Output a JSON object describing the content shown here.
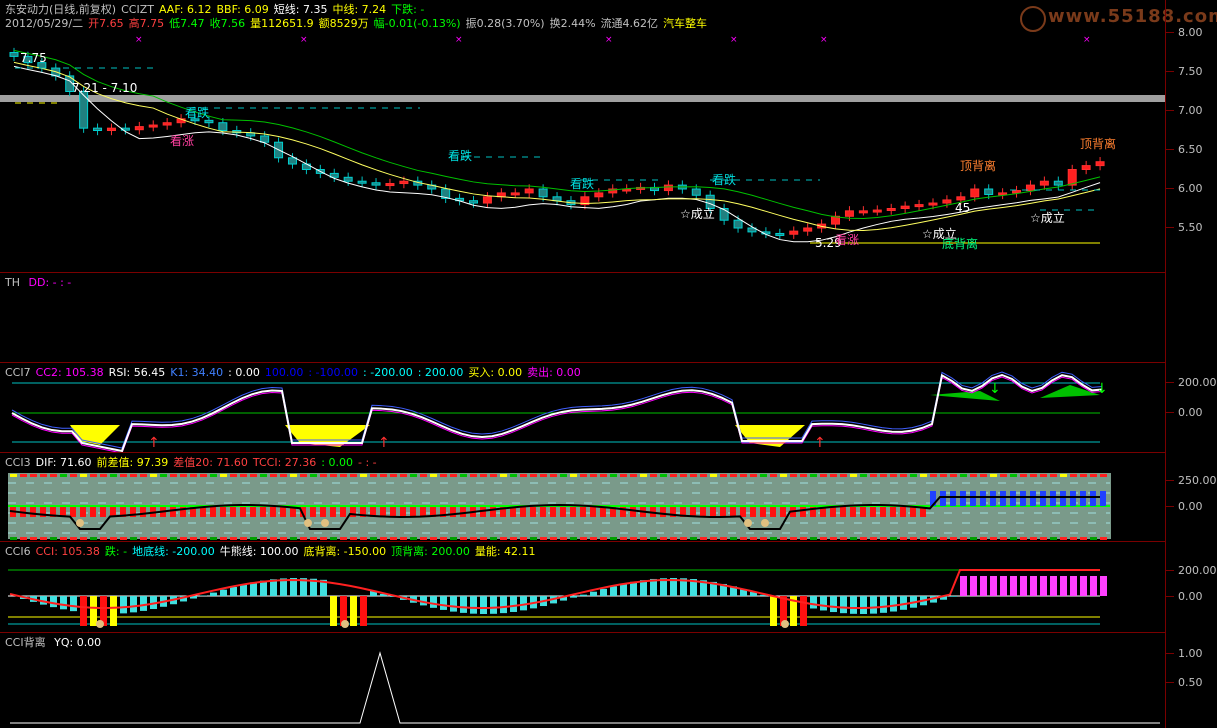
{
  "main": {
    "stock_name": "东安动力(日线,前复权)",
    "indicators": [
      {
        "label": "CCIZT",
        "color": "#c0c0c0"
      },
      {
        "label": "AAF: 6.12",
        "color": "#ffff00"
      },
      {
        "label": "BBF: 6.09",
        "color": "#ffff00"
      },
      {
        "label": "短线: 7.35",
        "color": "#ffffff"
      },
      {
        "label": "中线: 7.24",
        "color": "#ffff00"
      },
      {
        "label": "下跌: -",
        "color": "#00ff00"
      }
    ],
    "quote": [
      {
        "label": "2012/05/29/二",
        "color": "#c0c0c0"
      },
      {
        "label": "开7.65",
        "color": "#ff4040"
      },
      {
        "label": "高7.75",
        "color": "#ff4040"
      },
      {
        "label": "低7.47",
        "color": "#00ff00"
      },
      {
        "label": "收7.56",
        "color": "#00ff00"
      },
      {
        "label": "量112651.9",
        "color": "#ffff00"
      },
      {
        "label": "额8529万",
        "color": "#ffff00"
      },
      {
        "label": "幅-0.01(-0.13%)",
        "color": "#00ff00"
      },
      {
        "label": "振0.28(3.70%)",
        "color": "#c0c0c0"
      },
      {
        "label": "换2.44%",
        "color": "#c0c0c0"
      },
      {
        "label": "流通4.62亿",
        "color": "#c0c0c0"
      },
      {
        "label": "汽车整车",
        "color": "#ffff00"
      }
    ],
    "price_ticks": [
      "8.00",
      "7.50",
      "7.00",
      "6.50",
      "6.00",
      "5.50"
    ],
    "annotations": [
      {
        "text": "7.75",
        "color": "#ffffff"
      },
      {
        "text": "7.21 - 7.10",
        "color": "#ffffff"
      },
      {
        "text": "看跌",
        "color": "#00e0e0"
      },
      {
        "text": "看涨",
        "color": "#ff40a0"
      },
      {
        "text": "看跌",
        "color": "#00e0e0"
      },
      {
        "text": "看跌",
        "color": "#00e0e0"
      },
      {
        "text": "看跌",
        "color": "#00e0e0"
      },
      {
        "text": "☆成立",
        "color": "#ffffff"
      },
      {
        "text": "5.29",
        "color": "#ffffff"
      },
      {
        "text": "看涨",
        "color": "#ff40a0"
      },
      {
        "text": "顶背离",
        "color": "#ff8030"
      },
      {
        "text": "☆成立",
        "color": "#ffffff"
      },
      {
        "text": "底背离",
        "color": "#00ff80"
      },
      {
        "text": "顶背离",
        "color": "#ff8030"
      },
      {
        "text": "☆成立",
        "color": "#ffffff"
      },
      {
        "text": "45",
        "color": "#ffffff"
      }
    ]
  },
  "th_panel": {
    "label": "TH",
    "dd": "DD: -   : -"
  },
  "cci7": {
    "name": "CCI7",
    "items": [
      {
        "label": "CC2: 105.38",
        "color": "#ff00ff"
      },
      {
        "label": "RSI: 56.45",
        "color": "#ffffff"
      },
      {
        "label": "K1: 34.40",
        "color": "#4080ff"
      },
      {
        "label": ": 0.00",
        "color": "#ffffff"
      },
      {
        "label": "100.00",
        "color": "#0000ff"
      },
      {
        "label": ": -100.00",
        "color": "#0000ff"
      },
      {
        "label": ": -200.00",
        "color": "#00ffff"
      },
      {
        "label": ": 200.00",
        "color": "#00ffff"
      },
      {
        "label": "买入: 0.00",
        "color": "#ffff00"
      },
      {
        "label": "卖出: 0.00",
        "color": "#ff00ff"
      }
    ],
    "ticks": [
      "200.00",
      "0.00"
    ]
  },
  "cci3": {
    "name": "CCI3",
    "items": [
      {
        "label": "DIF: 71.60",
        "color": "#ffffff"
      },
      {
        "label": "前差值: 97.39",
        "color": "#ffff00"
      },
      {
        "label": "差值20: 71.60",
        "color": "#ff4040"
      },
      {
        "label": "TCCI: 27.36",
        "color": "#ff4040"
      },
      {
        "label": ": 0.00",
        "color": "#00ff00"
      },
      {
        "label": "- : -",
        "color": "#ff4040"
      }
    ],
    "ticks": [
      "250.00",
      "0.00"
    ]
  },
  "cci6": {
    "name": "CCI6",
    "items": [
      {
        "label": "CCI: 105.38",
        "color": "#ff4040"
      },
      {
        "label": "跌: -",
        "color": "#00ff00"
      },
      {
        "label": "地底线: -200.00",
        "color": "#00ffff"
      },
      {
        "label": "牛熊线: 100.00",
        "color": "#ffffff"
      },
      {
        "label": "底背离: -150.00",
        "color": "#ffff00"
      },
      {
        "label": "顶背离: 200.00",
        "color": "#00ff00"
      },
      {
        "label": "量能: 42.11",
        "color": "#ffff00"
      }
    ],
    "ticks": [
      "200.00",
      "0.00"
    ]
  },
  "ccibl": {
    "name": "CCI背离",
    "yq": "YQ: 0.00",
    "ticks": [
      "1.00",
      "0.50"
    ]
  },
  "watermark": "www.55188.com"
}
